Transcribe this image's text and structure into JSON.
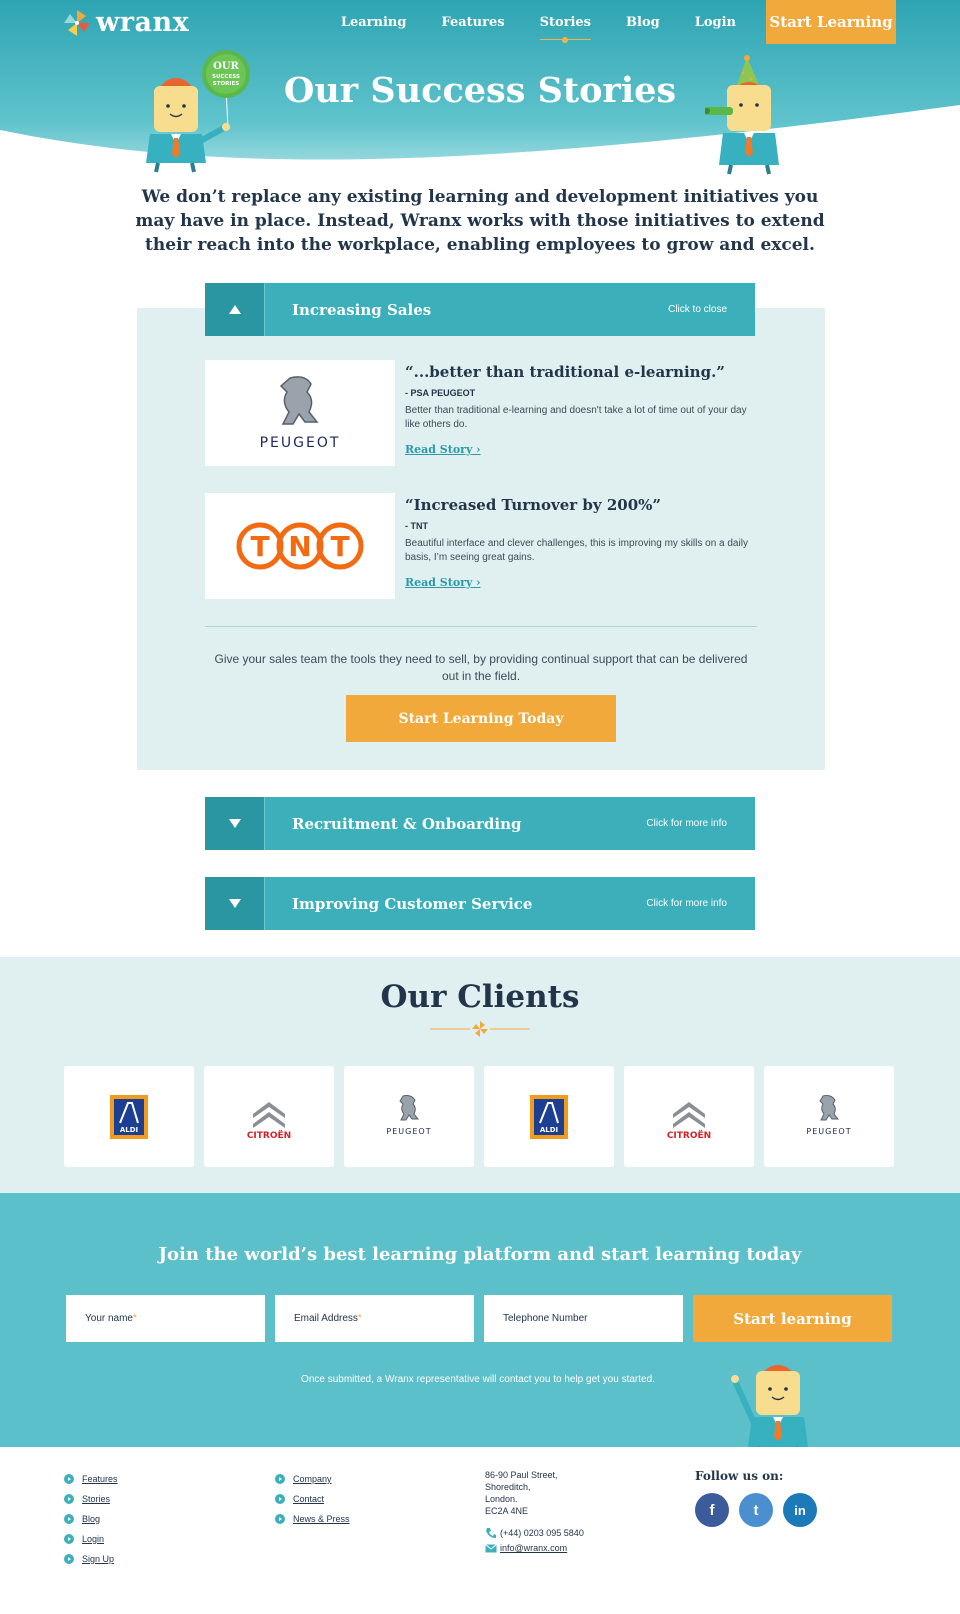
{
  "brand": {
    "name": "wranx"
  },
  "nav": {
    "items": [
      "Learning",
      "Features",
      "Stories",
      "Blog",
      "Login"
    ],
    "active": "Stories",
    "cta": "Start Learning"
  },
  "hero": {
    "title": "Our Success Stories",
    "balloon_text": [
      "OUR",
      "SUCCESS",
      "STORIES"
    ]
  },
  "intro": "We don’t replace any existing learning and development initiatives you may have in place. Instead, Wranx works with those initiatives to extend their reach into the workplace, enabling employees to grow and excel.",
  "accordion": {
    "open": {
      "title": "Increasing Sales",
      "hint": "Click to close",
      "stories": [
        {
          "logo": "PEUGEOT",
          "quote": "“...better than traditional e-learning.”",
          "by": "- PSA PEUGEOT",
          "text": "Better than traditional e-learning and doesn't take a lot of time out of your day like others do.",
          "link": "Read Story ›"
        },
        {
          "logo": "TNT",
          "quote": "“Increased Turnover by 200%”",
          "by": "- TNT",
          "text": "Beautiful interface and clever challenges, this is improving my skills on a daily basis, I’m seeing great gains.",
          "link": "Read Story ›"
        }
      ],
      "footer_text": "Give your sales team the tools they need to sell, by providing continual support that can be delivered out in the field.",
      "button": "Start Learning Today"
    },
    "closed": [
      {
        "title": "Recruitment & Onboarding",
        "hint": "Click for more info"
      },
      {
        "title": "Improving Customer Service",
        "hint": "Click for more info"
      }
    ]
  },
  "clients": {
    "title": "Our Clients",
    "logos": [
      {
        "name": "ALDI"
      },
      {
        "name": "CITROËN"
      },
      {
        "name": "PEUGEOT"
      },
      {
        "name": "ALDI"
      },
      {
        "name": "CITROËN"
      },
      {
        "name": "PEUGEOT"
      }
    ]
  },
  "signup": {
    "title": "Join the world’s best learning platform and start learning today",
    "name_placeholder": "Your name",
    "email_placeholder": "Email Address",
    "phone_placeholder": "Telephone Number",
    "required_mark": "*",
    "submit": "Start learning",
    "note": "Once submitted, a Wranx representative will contact you to help get you started."
  },
  "footer": {
    "col1": [
      "Features",
      "Stories",
      "Blog",
      "Login",
      "Sign Up"
    ],
    "col2": [
      "Company",
      "Contact",
      "News & Press"
    ],
    "address": [
      "86-90 Paul Street,",
      "Shoreditch,",
      "London.",
      "EC2A 4NE"
    ],
    "phone": "(+44) 0203 095 5840",
    "email": "info@wranx.com",
    "follow": "Follow us on:",
    "social": [
      {
        "name": "facebook",
        "glyph": "f",
        "color": "#3b5b9a"
      },
      {
        "name": "twitter",
        "glyph": "t",
        "color": "#4b8fd0"
      },
      {
        "name": "linkedin",
        "glyph": "in",
        "color": "#1b7ab7"
      }
    ]
  },
  "colors": {
    "teal": "#3bb0bb",
    "dark_teal": "#2a96a2",
    "orange": "#f2a93b",
    "navy": "#22354a",
    "pale": "#e0f0f1"
  }
}
